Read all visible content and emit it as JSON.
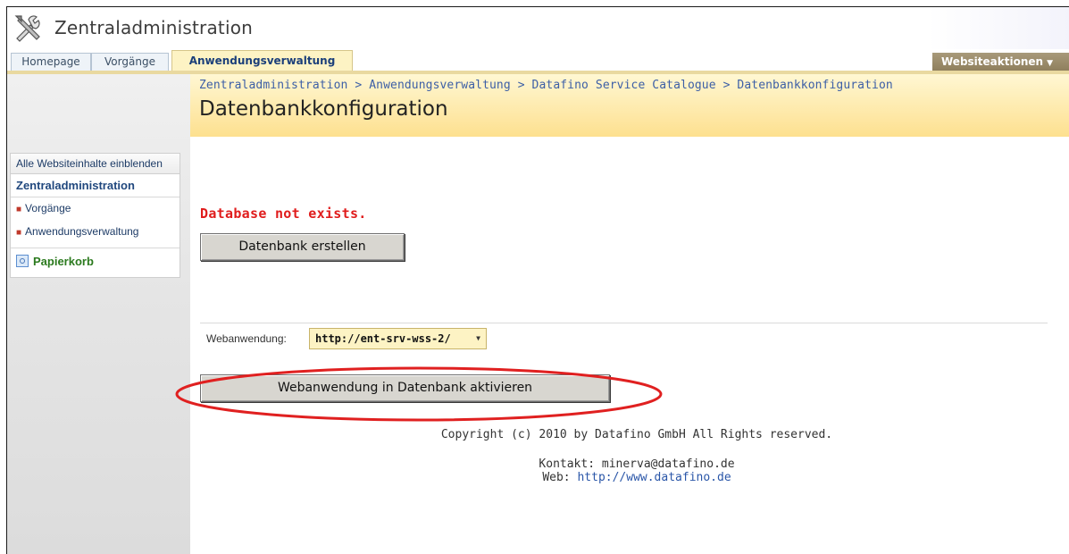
{
  "window": {
    "title": "Zentraladministration",
    "icon": "tools-icon"
  },
  "tabs": [
    {
      "label": "Homepage",
      "active": false
    },
    {
      "label": "Vorgänge",
      "active": false
    },
    {
      "label": "Anwendungsverwaltung",
      "active": true
    }
  ],
  "site_actions": {
    "label": "Websiteaktionen",
    "icon": "chevron-down-icon"
  },
  "breadcrumb": {
    "text": "Zentraladministration > Anwendungsverwaltung > Datafino Service Catalogue > Datenbankkonfiguration"
  },
  "page": {
    "title": "Datenbankkonfiguration"
  },
  "quicklaunch": {
    "view_all": "Alle Websiteinhalte einblenden",
    "heading": "Zentraladministration",
    "items": [
      "Vorgänge",
      "Anwendungsverwaltung"
    ],
    "recycle_bin": "Papierkorb"
  },
  "main": {
    "error_message": "Database not exists.",
    "create_db_button": "Datenbank erstellen",
    "webapp_label": "Webanwendung:",
    "webapp_value": "http://ent-srv-wss-2/",
    "activate_button": "Webanwendung in Datenbank aktivieren",
    "highlight_color": "#e02020"
  },
  "footer": {
    "copyright": "Copyright (c) 2010 by Datafino GmbH All Rights reserved.",
    "contact": "Kontakt: minerva@datafino.de",
    "web_prefix": "Web: ",
    "web_link": "http://www.datafino.de"
  },
  "colors": {
    "tab_active_bg": "#fdf3c4",
    "site_actions_bg": "#8f7f5d",
    "error": "#e01c1c",
    "link": "#2a56a8",
    "recycle": "#2b7a1e"
  }
}
